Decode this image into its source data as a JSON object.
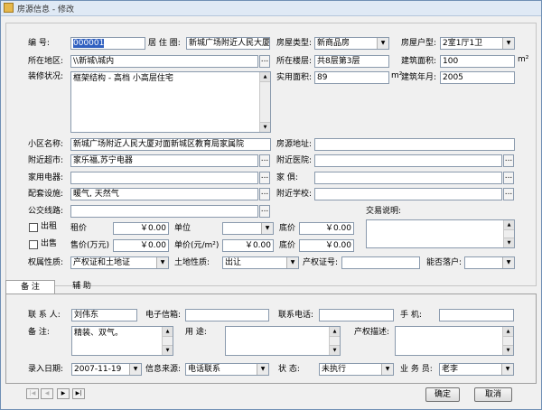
{
  "window": {
    "title": "房源信息 - 修改"
  },
  "main": {
    "biaohao": {
      "label": "编   号:",
      "value": "000001"
    },
    "juzhuquan": {
      "label": "居 住 圈:",
      "value": "新城广场附近人民大厦"
    },
    "fangwuleixing": {
      "label": "房屋类型:",
      "value": "新商品房"
    },
    "fangwuhuxing": {
      "label": "房屋户型:",
      "value": "2室1厅1卫"
    },
    "suozaidiqu": {
      "label": "所在地区:",
      "value": "\\\\新城\\城内"
    },
    "suozailouceng": {
      "label": "所在楼层:",
      "value": "共8层第3层"
    },
    "jianzhumianji": {
      "label": "建筑面积:",
      "value": "100",
      "unit": "m²"
    },
    "zhuangxiu": {
      "label": "装修状况:",
      "value": "框架结构 - 高档 小高层住宅"
    },
    "shiyongmianji": {
      "label": "实用面积:",
      "value": "89",
      "unit": "m²"
    },
    "jianzhunianyue": {
      "label": "建筑年月:",
      "value": "2005"
    },
    "xiaoqu": {
      "label": "小区名称:",
      "value": "新城广场附近人民大厦对面新城区教育局家属院"
    },
    "fangyuandizhi": {
      "label": "房源地址:",
      "value": ""
    },
    "fujinchaoshi": {
      "label": "附近超市:",
      "value": "家乐福,苏宁电器"
    },
    "fujinyiyuan": {
      "label": "附近医院:",
      "value": ""
    },
    "jiayongdianqi": {
      "label": "家用电器:",
      "value": ""
    },
    "jiaju": {
      "label": "家   俱:",
      "value": ""
    },
    "peitao": {
      "label": "配套设施:",
      "value": "暖气, 天然气"
    },
    "fujinxuexiao": {
      "label": "附近学校:",
      "value": ""
    },
    "gongjiao": {
      "label": "公交线路:",
      "value": ""
    },
    "jiaoyishuoming": {
      "label": "交易说明:",
      "value": ""
    },
    "chuzu": {
      "label": "出租",
      "zujia_label": "租价",
      "zujia": "￥0.00",
      "danwei_label": "单位",
      "danwei": "",
      "dijia_label": "底价",
      "dijia": "￥0.00"
    },
    "chushou": {
      "label": "出售",
      "shoujia_label": "售价(万元)",
      "shoujia": "￥0.00",
      "danjia_label": "单价(元/m²)",
      "danjia": "￥0.00",
      "dijia_label": "底价",
      "dijia": "￥0.00"
    },
    "quanshu": {
      "label": "权属性质:",
      "value": "产权证和土地证"
    },
    "tudi": {
      "label": "土地性质:",
      "value": "出让"
    },
    "chanquan": {
      "label": "产权证号:",
      "value": ""
    },
    "luohu": {
      "label": "能否落户:",
      "value": ""
    }
  },
  "tabs": [
    {
      "label": "备   注"
    },
    {
      "label": "辅   助"
    }
  ],
  "notes": {
    "lianxiren": {
      "label": "联 系 人:",
      "value": "刘伟东"
    },
    "email": {
      "label": "电子信箱:",
      "value": ""
    },
    "dianhua": {
      "label": "联系电话:",
      "value": ""
    },
    "shouji": {
      "label": "手    机:",
      "value": ""
    },
    "beizhu": {
      "label": "备   注:",
      "value": "精装、双气。"
    },
    "yongtu": {
      "label": "用   途:",
      "value": ""
    },
    "chanquanmiaoshu": {
      "label": "产权描述:",
      "value": ""
    },
    "luruiriqi": {
      "label": "录入日期:",
      "value": "2007-11-19"
    },
    "xinxilaiyuan": {
      "label": "信息来源:",
      "value": "电话联系"
    },
    "zhuangtai": {
      "label": "状   态:",
      "value": "未执行"
    },
    "yewuyuan": {
      "label": "业 务 员:",
      "value": "老李"
    }
  },
  "buttons": {
    "ok": "确定",
    "cancel": "取消"
  },
  "nav": {
    "first": "|◀",
    "prev": "◀",
    "next": "▶",
    "last": "▶|"
  },
  "icons": {
    "arrow": "▼",
    "more": "..."
  }
}
